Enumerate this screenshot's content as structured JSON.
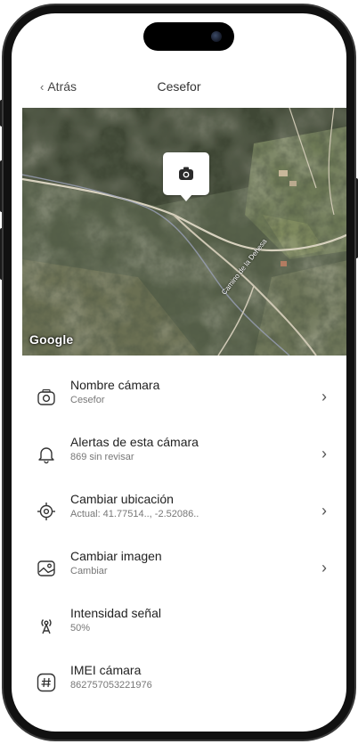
{
  "nav": {
    "back_label": "Atrás",
    "title": "Cesefor"
  },
  "map": {
    "attribution": "Google",
    "road_label": "Camino de la Dehesa"
  },
  "settings": [
    {
      "label": "Nombre cámara",
      "sub": "Cesefor",
      "icon": "camera-icon",
      "has_arrow": true
    },
    {
      "label": "Alertas de esta cámara",
      "sub": "869 sin revisar",
      "icon": "bell-icon",
      "has_arrow": true
    },
    {
      "label": "Cambiar ubicación",
      "sub": "Actual: 41.77514.., -2.52086..",
      "icon": "location-target-icon",
      "has_arrow": true
    },
    {
      "label": "Cambiar imagen",
      "sub": "Cambiar",
      "icon": "image-icon",
      "has_arrow": true
    },
    {
      "label": "Intensidad señal",
      "sub": "50%",
      "icon": "signal-antenna-icon",
      "has_arrow": false
    },
    {
      "label": "IMEI cámara",
      "sub": "862757053221976",
      "icon": "hash-icon",
      "has_arrow": false
    }
  ],
  "colors": {
    "text_primary": "#222222",
    "text_secondary": "#777777",
    "frame": "#111111"
  }
}
